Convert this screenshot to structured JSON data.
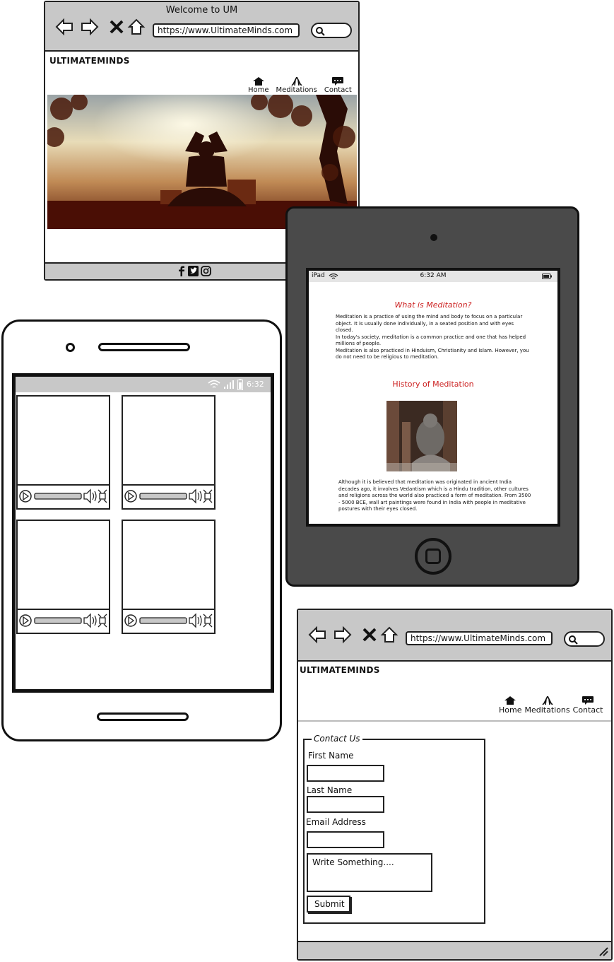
{
  "browser_home": {
    "window_title": "Welcome to UM",
    "url": "https://www.UltimateMinds.com",
    "brand": "ULTIMATEMINDS",
    "nav": [
      {
        "label": "Home",
        "icon": "home-icon"
      },
      {
        "label": "Meditations",
        "icon": "praying-hands-icon"
      },
      {
        "label": "Contact",
        "icon": "message-icon"
      }
    ],
    "hero_image": "meditation-silhouette-sunset",
    "footer_icons": [
      "facebook-icon",
      "twitter-icon",
      "instagram-icon"
    ]
  },
  "tablet": {
    "status_left": "iPad",
    "status_time": "6:32 AM",
    "heading1": "What is Meditation?",
    "paragraph1": "Meditation is a practice of using the mind and body to focus on a particular object. It is usually done individually, in a seated position and with eyes closed.",
    "paragraph2": "In today's society, meditation is a common practice and one that has helped millions of people.",
    "paragraph3": "Meditation is also practiced in Hinduism, Christianity and Islam. However, you do not need to be religious to meditation.",
    "heading2": "History of Meditation",
    "history_text": "Although it is believed that meditation was originated in ancient India decades ago, it involves Vedantism which is a Hindu tradition, other cultures and religions across the world also practiced a form of meditation. From 3500 - 5000 BCE, wall art paintings were found in India with people in meditative postures with their eyes closed.",
    "accent": "#cc2222"
  },
  "phone": {
    "status_time": "6:32",
    "videos": [
      "video-1",
      "video-2",
      "video-3",
      "video-4"
    ]
  },
  "browser_contact": {
    "url": "https://www.UltimateMinds.com",
    "brand": "ULTIMATEMINDS",
    "nav": [
      {
        "label": "Home",
        "icon": "home-icon"
      },
      {
        "label": "Meditations",
        "icon": "praying-hands-icon"
      },
      {
        "label": "Contact",
        "icon": "message-icon"
      }
    ],
    "form": {
      "legend": "Contact Us",
      "first_name_label": "First Name",
      "last_name_label": "Last Name",
      "email_label": "Email Address",
      "message_placeholder": "Write Something....",
      "submit_label": "Submit"
    }
  }
}
